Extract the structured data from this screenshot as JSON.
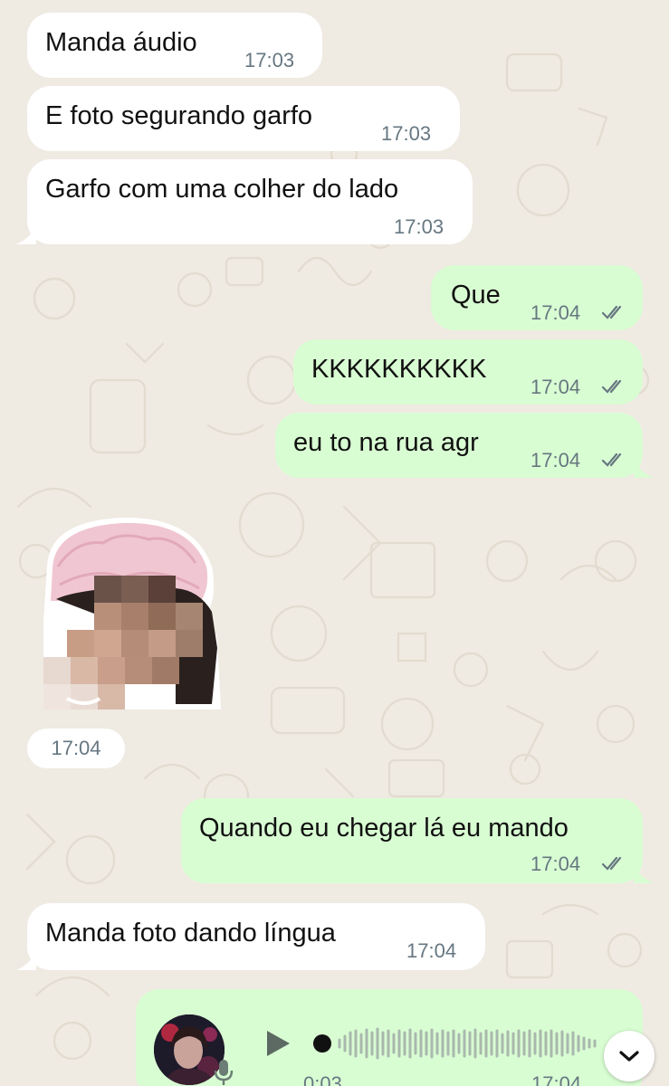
{
  "messages": [
    {
      "direction": "in",
      "text": "Manda áudio",
      "time": "17:03"
    },
    {
      "direction": "in",
      "text": "E foto segurando garfo",
      "time": "17:03"
    },
    {
      "direction": "in",
      "text": "Garfo com uma colher do lado",
      "time": "17:03"
    },
    {
      "direction": "out",
      "text": "Que",
      "time": "17:04",
      "status": "read"
    },
    {
      "direction": "out",
      "text": "KKKKKKKKKK",
      "time": "17:04",
      "status": "read"
    },
    {
      "direction": "out",
      "text": "eu to na rua agr",
      "time": "17:04",
      "status": "read"
    },
    {
      "direction": "in",
      "type": "sticker",
      "time": "17:04"
    },
    {
      "direction": "out",
      "text": "Quando eu chegar lá eu mando",
      "time": "17:04",
      "status": "read"
    },
    {
      "direction": "in",
      "text": "Manda foto dando língua",
      "time": "17:04"
    },
    {
      "direction": "out",
      "type": "voice",
      "duration": "0:03",
      "time": "17:04"
    }
  ],
  "colors": {
    "background": "#efeae2",
    "incoming_bubble": "#ffffff",
    "outgoing_bubble": "#d9fdd3",
    "timestamp": "#667781",
    "read_ticks": "#667781"
  },
  "icons": {
    "read_status": "double-check-icon",
    "voice_play": "play-icon",
    "voice_mic": "microphone-icon",
    "scroll_down": "chevron-down-icon"
  }
}
